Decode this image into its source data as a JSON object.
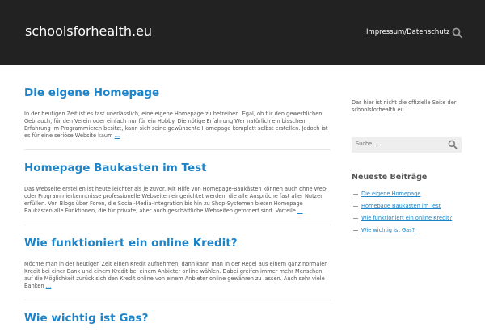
{
  "header": {
    "site_title": "schoolsforhealth.eu",
    "nav_link": "Impressum/Datenschutz",
    "search_icon": "search-icon"
  },
  "posts": [
    {
      "title": "Die eigene Homepage",
      "excerpt": "In der heutigen Zeit ist es fast unerlässlich, eine eigene Homepage zu betreiben. Egal, ob für den gewerblichen Gebrauch, für den Verein oder einfach nur für ein Hobby. Die nötige Erfahrung Wer natürlich ein bisschen Erfahrung im Programmieren besitzt, kann sich seine gewünschte Homepage komplett selbst erstellen. Jedoch ist es für eine seriöse Website kaum",
      "more": "…"
    },
    {
      "title": "Homepage Baukasten im Test",
      "excerpt": "Das Webseite erstellen ist heute leichter als je zuvor. Mit Hilfe von Homepage-Baukästen können auch ohne Web- oder Programmierkenntnisse professionelle Webseiten eingerichtet werden, die alle Ansprüche fast aller Nutzer erfüllen. Von Blogs über Foren, die Social-Media-Integration bis hin zu Shop-Systemen bieten Homepage Baukästen alle Funktionen, die für private, aber auch geschäftliche Webseiten gefordert sind. Vorteile",
      "more": "…"
    },
    {
      "title": "Wie funktioniert ein online Kredit?",
      "excerpt": "Möchte man in der heutigen Zeit einen Kredit aufnehmen, dann kann man in der Regel aus einem ganz normalen Kredit bei einer Bank und einem Kredit bei einem Anbieter online wählen. Dabei greifen immer mehr Menschen auf die Möglichkeit zurück sich den Kredit online von einem Anbieter online gewähren zu lassen. Auch sehr viele Banken",
      "more": "…"
    },
    {
      "title": "Wie wichtig ist Gas?",
      "excerpt": "",
      "more": ""
    }
  ],
  "sidebar": {
    "description": "Das hier ist nicht die offizielle Seite der schoolsforhealth.eu",
    "search_placeholder": "Suche …",
    "widget_title": "Neueste Beiträge",
    "recent": [
      "Die eigene Homepage",
      "Homepage Baukasten im Test",
      "Wie funktioniert ein online Kredit?",
      "Wie wichtig ist Gas?"
    ]
  },
  "colors": {
    "header_bg": "#222222",
    "link": "#1e84c8"
  }
}
